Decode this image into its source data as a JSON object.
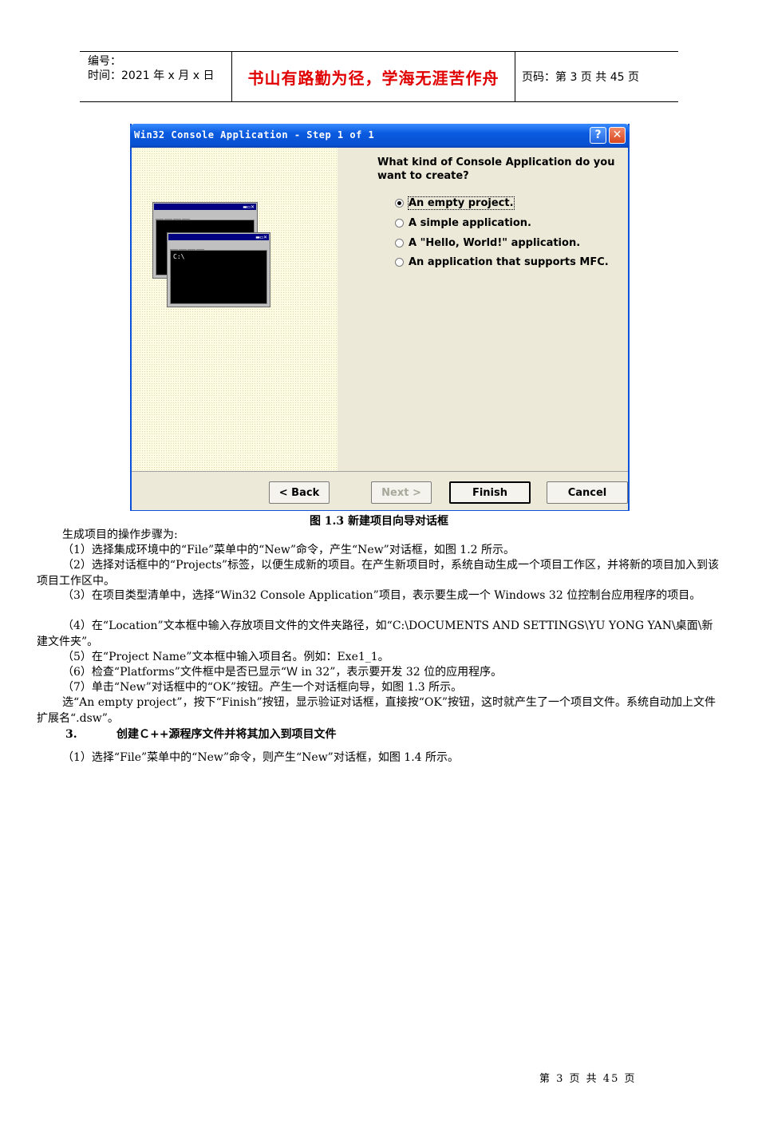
{
  "header": {
    "number_label": "编号：",
    "time_label": "时间：2021 年 x 月 x 日",
    "motto": "书山有路勤为径，学海无涯苦作舟",
    "page_info": "页码：第 3 页  共 45 页"
  },
  "dialog": {
    "title": "Win32 Console Application - Step 1 of 1",
    "help_glyph": "?",
    "close_glyph": "✕",
    "mini_window_text": "C:\\",
    "question": "What kind of Console Application do you want to create?",
    "options": [
      {
        "label": "An empty project.",
        "selected": true
      },
      {
        "label": "A simple application.",
        "selected": false
      },
      {
        "label": "A \"Hello, World!\" application.",
        "selected": false
      },
      {
        "label": "An application that supports MFC.",
        "selected": false
      }
    ],
    "buttons": {
      "back": "< Back",
      "next": "Next >",
      "finish": "Finish",
      "cancel": "Cancel"
    }
  },
  "caption": "图 1.3  新建项目向导对话框",
  "paragraphs": [
    "生成项目的操作步骤为:",
    "（1）选择集成环境中的“File”菜单中的“New”命令，产生“New”对话框，如图 1.2 所示。",
    "（2）选择对话框中的“Projects”标签，以便生成新的项目。在产生新项目时，系统自动生成一个项目工作区，并将新的项目加入到该项目工作区中。",
    "（3）在项目类型清单中，选择“Win32 Console Application”项目，表示要生成一个 Windows 32 位控制台应用程序的项目。",
    "（4）在“Location”文本框中输入存放项目文件的文件夹路径，如“C:\\DOCUMENTS AND SETTINGS\\YU YONG YAN\\桌面\\新建文件夹”。",
    "（5）在“Project Name”文本框中输入项目名。例如：Exe1_1。",
    "（6）检查“Platforms”文件框中是否已显示“Ｗ in 32”，表示要开发 32 位的应用程序。",
    "（7）单击“New”对话框中的“OK”按钮。产生一个对话框向导，如图 1.3 所示。",
    "选“An empty project”，按下“Finish”按钮，显示验证对话框，直接按“OK”按钮，这时就产生了一个项目文件。系统自动加上文件扩展名“.dsw”。"
  ],
  "section3": {
    "number": "3.",
    "title": "创建Ｃ++源程序文件并将其加入到项目文件"
  },
  "para_last": "（1）选择“File”菜单中的“New”命令，则产生“New”对话框，如图 1.4 所示。",
  "footer": "第 3 页 共 45 页"
}
